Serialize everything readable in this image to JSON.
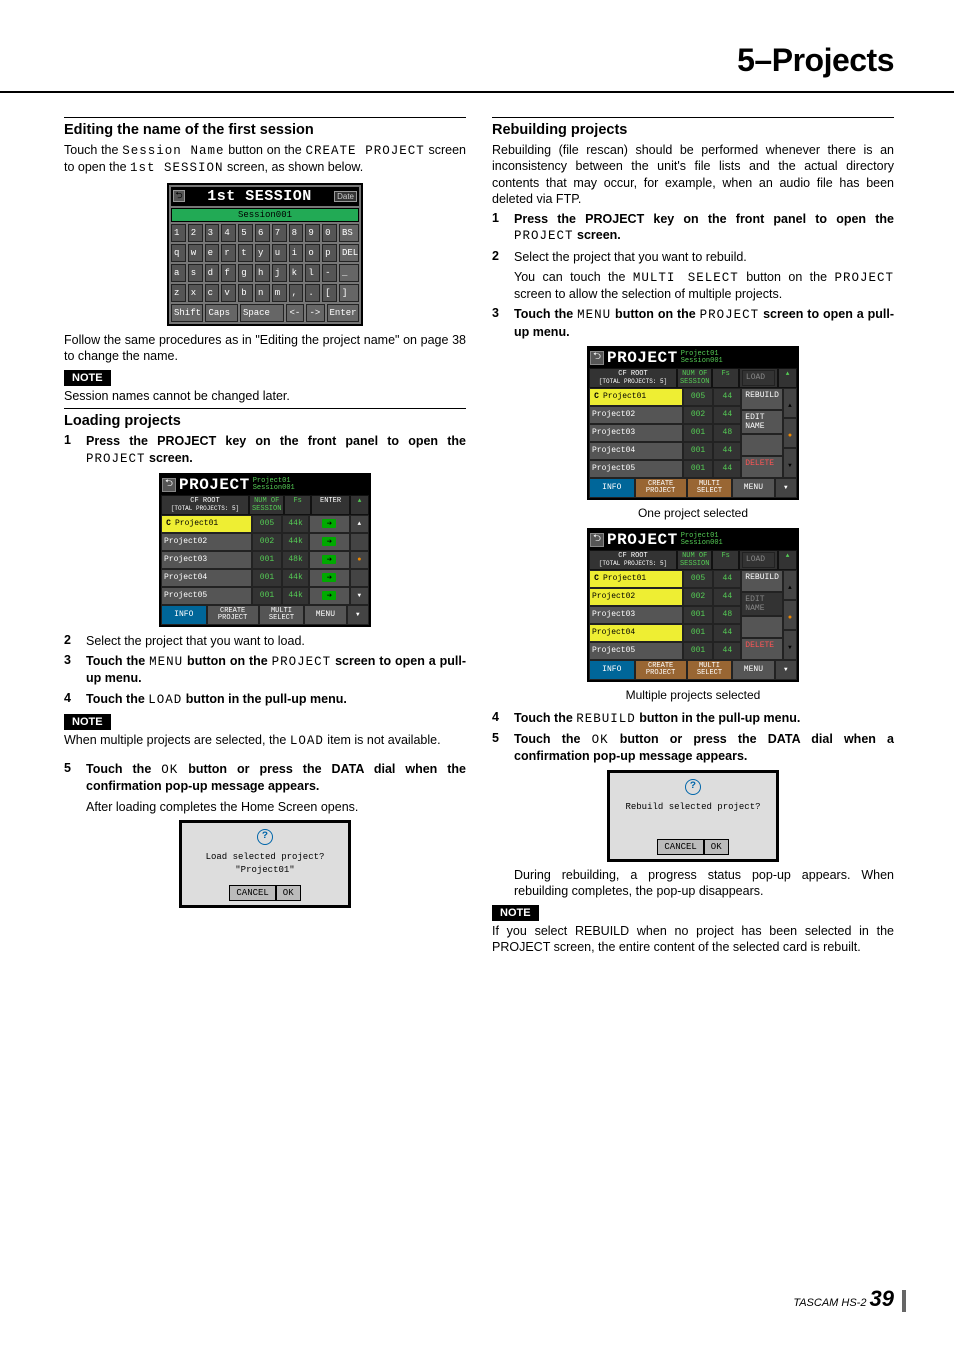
{
  "header": {
    "chapter": "5–Projects"
  },
  "footer": {
    "product": "TASCAM HS-2",
    "page": "39"
  },
  "left": {
    "sec1_title": "Editing the name of the first session",
    "sec1_p1a": "Touch the ",
    "sec1_p1b": "Session Name",
    "sec1_p1c": " button on the ",
    "sec1_p1d": "CREATE PROJECT",
    "sec1_p1e": " screen to open the ",
    "sec1_p1f": "1st SESSION",
    "sec1_p1g": " screen, as shown below.",
    "kbd": {
      "title": "1st SESSION",
      "date": "Date",
      "input": "Session001",
      "row1": [
        "1",
        "2",
        "3",
        "4",
        "5",
        "6",
        "7",
        "8",
        "9",
        "0",
        "BS"
      ],
      "row2": [
        "q",
        "w",
        "e",
        "r",
        "t",
        "y",
        "u",
        "i",
        "o",
        "p",
        "DEL"
      ],
      "row3": [
        "a",
        "s",
        "d",
        "f",
        "g",
        "h",
        "j",
        "k",
        "l",
        "-",
        "_"
      ],
      "row4": [
        "z",
        "x",
        "c",
        "v",
        "b",
        "n",
        "m",
        ",",
        ".",
        "[",
        "]"
      ],
      "row5": [
        "Shift",
        "Caps",
        "Space",
        "<-",
        "->",
        "Enter"
      ]
    },
    "sec1_p2": "Follow the same procedures as in \"Editing the project name\" on page 38 to change the name.",
    "note_label": "NOTE",
    "sec1_note": "Session names cannot be changed later.",
    "sec2_title": "Loading projects",
    "step1a": "Press the PROJECT key on the front panel to open the ",
    "step1b": "PROJECT",
    "step1c": " screen.",
    "proj_title": "PROJECT",
    "proj_sub1": "Project01",
    "proj_sub2": "Session001",
    "proj_root": "CF ROOT",
    "proj_total": "[TOTAL PROJECTS: 5]",
    "proj_h2": "NUM OF SESSION",
    "proj_h3": "Fs",
    "proj_h4": "ENTER",
    "proj_rows": [
      {
        "name": "Project01",
        "num": "005",
        "fs": "44k",
        "sel": true,
        "mark": true
      },
      {
        "name": "Project02",
        "num": "002",
        "fs": "44k"
      },
      {
        "name": "Project03",
        "num": "001",
        "fs": "48k"
      },
      {
        "name": "Project04",
        "num": "001",
        "fs": "44k"
      },
      {
        "name": "Project05",
        "num": "001",
        "fs": "44k"
      }
    ],
    "proj_f1": "INFO",
    "proj_f2a": "CREATE",
    "proj_f2b": "PROJECT",
    "proj_f3a": "MULTI",
    "proj_f3b": "SELECT",
    "proj_f4": "MENU",
    "step2": "Select the project that you want to load.",
    "step3a": "Touch the ",
    "step3b": "MENU",
    "step3c": " button on the ",
    "step3d": "PROJECT",
    "step3e": " screen to open a pull-up menu.",
    "step4a": "Touch the ",
    "step4b": "LOAD",
    "step4c": " button in the pull-up menu.",
    "note2a": "When multiple projects are selected, the ",
    "note2b": "LOAD",
    "note2c": " item is not available.",
    "step5a": "Touch the ",
    "step5b": "OK",
    "step5c": " button or press the DATA dial when the confirmation pop-up message appears.",
    "step5_sub": "After loading completes the Home Screen opens.",
    "popup": {
      "line1": "Load selected project?",
      "line2": "\"Project01\"",
      "cancel": "CANCEL",
      "ok": "OK"
    }
  },
  "right": {
    "sec1_title": "Rebuilding projects",
    "sec1_p1": "Rebuilding (file rescan) should be performed whenever there is an inconsistency between the unit's file lists and the actual directory contents that may occur, for example, when an audio file has been deleted via FTP.",
    "step1a": "Press the PROJECT key on the front panel to open the ",
    "step1b": "PROJECT",
    "step1c": " screen.",
    "step2": "Select the project that you want to rebuild.",
    "step2_suba": "You can touch the ",
    "step2_subb": "MULTI SELECT",
    "step2_subc": " button on the ",
    "step2_subd": "PROJECT",
    "step2_sube": " screen to allow the selection of multiple projects.",
    "step3a": "Touch the ",
    "step3b": "MENU",
    "step3c": " button on the ",
    "step3d": "PROJECT",
    "step3e": " screen to open a pull-up menu.",
    "menu": {
      "load": "LOAD",
      "rebuild": "REBUILD",
      "edit": "EDIT NAME",
      "delete": "DELETE"
    },
    "proj1_rows": [
      {
        "name": "Project01",
        "num": "005",
        "fs": "44",
        "sel": true,
        "mark": true
      },
      {
        "name": "Project02",
        "num": "002",
        "fs": "44"
      },
      {
        "name": "Project03",
        "num": "001",
        "fs": "48"
      },
      {
        "name": "Project04",
        "num": "001",
        "fs": "44"
      },
      {
        "name": "Project05",
        "num": "001",
        "fs": "44"
      }
    ],
    "caption1": "One project selected",
    "proj2_rows": [
      {
        "name": "Project01",
        "num": "005",
        "fs": "44",
        "sel": true,
        "mark": true
      },
      {
        "name": "Project02",
        "num": "002",
        "fs": "44",
        "sel": true
      },
      {
        "name": "Project03",
        "num": "001",
        "fs": "48"
      },
      {
        "name": "Project04",
        "num": "001",
        "fs": "44",
        "sel": true
      },
      {
        "name": "Project05",
        "num": "001",
        "fs": "44"
      }
    ],
    "caption2": "Multiple projects selected",
    "step4a": "Touch the ",
    "step4b": "REBUILD",
    "step4c": " button in the pull-up menu.",
    "step5a": "Touch the ",
    "step5b": "OK",
    "step5c": " button or press the DATA dial when a confirmation pop-up message appears.",
    "popup": {
      "line1": "Rebuild selected project?",
      "cancel": "CANCEL",
      "ok": "OK"
    },
    "step5_sub": "During rebuilding, a progress status pop-up appears. When rebuilding completes, the pop-up disappears.",
    "note_label": "NOTE",
    "note_text": "If you select REBUILD when no project has been selected in the PROJECT screen, the entire content of the selected card is rebuilt."
  }
}
